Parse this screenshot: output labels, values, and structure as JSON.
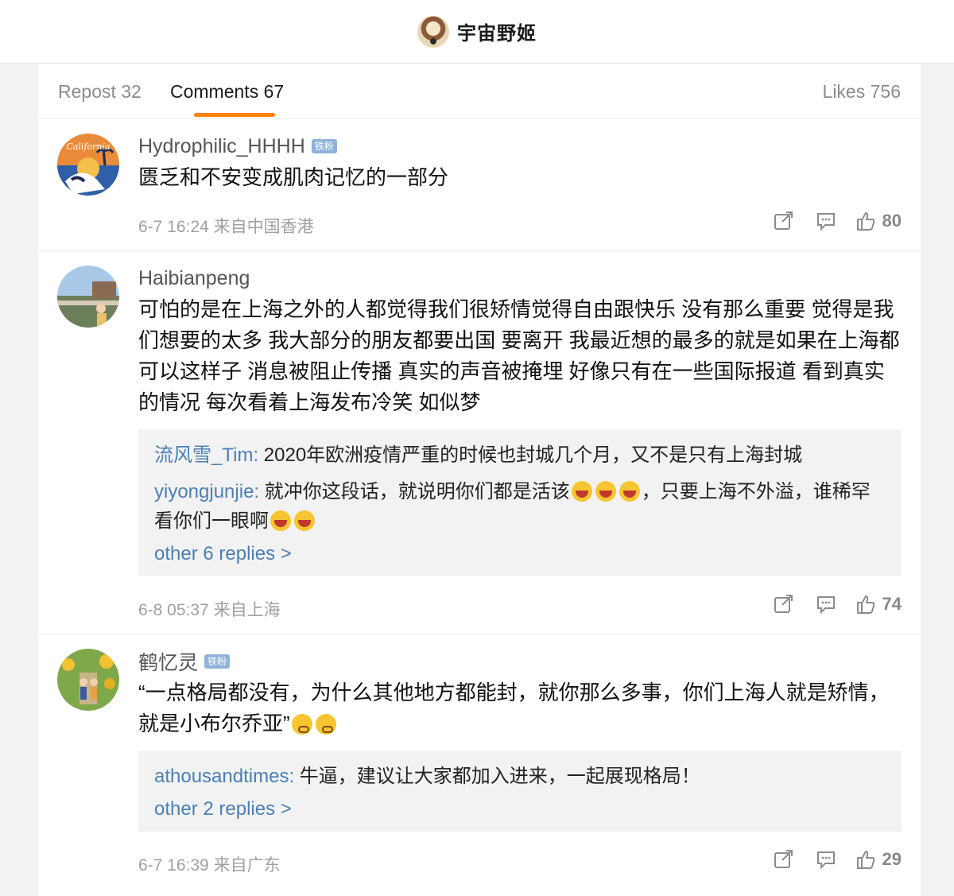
{
  "header": {
    "title": "宇宙野姬"
  },
  "tabs": {
    "repost": "Repost 32",
    "comments": "Comments 67",
    "likes": "Likes 756"
  },
  "colors": {
    "accent": "#ff8200",
    "link": "#4a7fb5",
    "badge": "#8fb2d9"
  },
  "comments": [
    {
      "username": "Hydrophilic_HHHH",
      "badge": "铁粉",
      "text": "匮乏和不安变成肌肉记忆的一部分",
      "time": "6-7 16:24 来自中国香港",
      "likes": "80",
      "avatar_icon": "california-avatar"
    },
    {
      "username": "Haibianpeng",
      "text": "可怕的是在上海之外的人都觉得我们很矫情觉得自由跟快乐 没有那么重要 觉得是我们想要的太多 我大部分的朋友都要出国 要离开 我最近想的最多的就是如果在上海都可以这样子 消息被阻止传播 真实的声音被掩埋 好像只有在一些国际报道 看到真实的情况 每次看着上海发布冷笑 如似梦",
      "replies": [
        {
          "user": "流风雪_Tim:",
          "text": " 2020年欧洲疫情严重的时候也封城几个月，又不是只有上海封城"
        },
        {
          "user": "yiyongjunjie:",
          "text": " 就冲你这段话，就说明你们都是活该",
          "text2": "，只要上海不外溢，谁稀罕看你们一眼啊"
        }
      ],
      "more": "other 6 replies >",
      "time": "6-8 05:37 来自上海",
      "likes": "74"
    },
    {
      "username": "鹤忆灵",
      "badge": "铁粉",
      "text": "“一点格局都没有，为什么其他地方都能封，就你那么多事，你们上海人就是矫情，就是小布尔乔亚”",
      "replies": [
        {
          "user": "athousandtimes:",
          "text": " 牛逼，建议让大家都加入进来，一起展现格局！"
        }
      ],
      "more": "other 2 replies >",
      "time": "6-7 16:39 来自广东",
      "likes": "29"
    }
  ]
}
